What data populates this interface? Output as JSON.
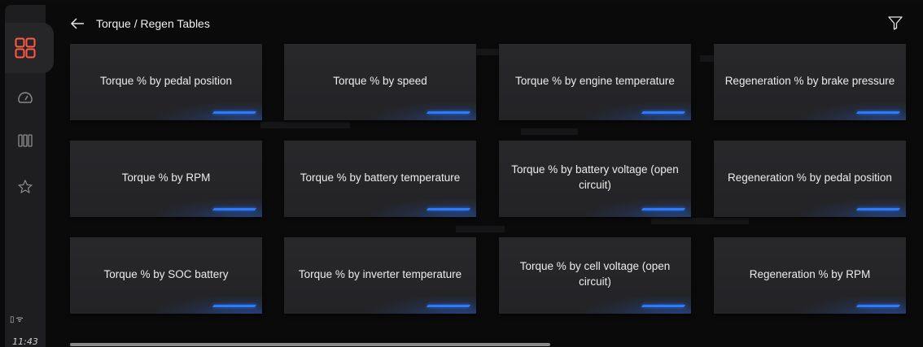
{
  "header": {
    "title": "Torque / Regen Tables"
  },
  "sidebar": {
    "nav_items": [
      "apps-icon",
      "gauge-icon",
      "columns-icon",
      "star-icon"
    ],
    "clock": "11:43"
  },
  "cards": [
    "Torque % by pedal position",
    "Torque % by speed",
    "Torque % by engine temperature",
    "Regeneration % by brake pressure",
    "Torque % by RPM",
    "Torque % by battery temperature",
    "Torque % by battery voltage (open circuit)",
    "Regeneration % by pedal position",
    "Torque % by SOC battery",
    "Torque % by inverter temperature",
    "Torque % by cell voltage (open circuit)",
    "Regeneration % by  RPM"
  ],
  "colors": {
    "accent": "#2b7bff",
    "active_icon": "#ff5a47",
    "card_bg": "#28282b",
    "background": "#0a0a0b"
  }
}
